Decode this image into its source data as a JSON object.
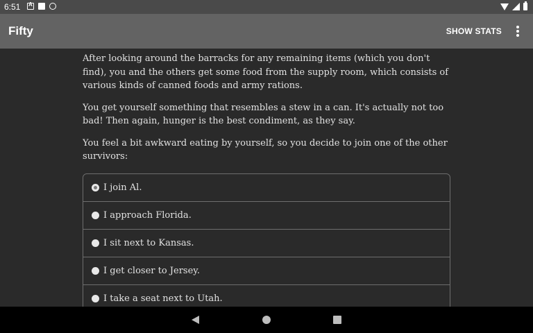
{
  "status_bar": {
    "time": "6:51",
    "left_icons": [
      "notification-a-icon",
      "sd-card-icon",
      "sync-icon"
    ],
    "right_icons": [
      "wifi-icon",
      "signal-icon",
      "battery-icon"
    ]
  },
  "app_bar": {
    "title": "Fifty",
    "show_stats_label": "SHOW STATS",
    "menu_icon": "more-vert-icon"
  },
  "content": {
    "paragraphs": [
      "After looking around the barracks for any remaining items (which you don't find), you and the others get some food from the supply room, which consists of various kinds of canned foods and army rations.",
      "You get yourself something that resembles a stew in a can. It's actually not too bad! Then again, hunger is the best condiment, as they say.",
      "You feel a bit awkward eating by yourself, so you decide to join one of the other survivors:"
    ],
    "choices": [
      {
        "label": "I join Al.",
        "selected": true
      },
      {
        "label": "I approach Florida.",
        "selected": false
      },
      {
        "label": "I sit next to Kansas.",
        "selected": false
      },
      {
        "label": "I get closer to Jersey.",
        "selected": false
      },
      {
        "label": "I take a seat next to Utah.",
        "selected": false
      }
    ]
  },
  "nav_bar": {
    "icons": [
      "back-icon",
      "home-icon",
      "recents-icon"
    ]
  },
  "colors": {
    "background": "#2a2a2a",
    "app_bar": "#636363",
    "status_bar": "#4a4a4a",
    "text": "#e2e2e2"
  }
}
